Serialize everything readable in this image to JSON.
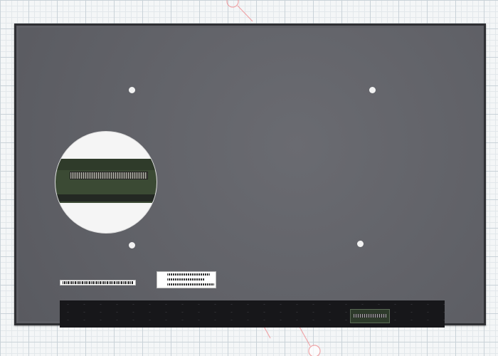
{
  "product": {
    "top_marking": "",
    "colors": {
      "panel": "#5f6066",
      "bezel": "#2e2f33",
      "backdrop_grid": "#c9d2d8",
      "watermark": "#e8424a"
    }
  },
  "zoom_inset": {
    "subject": "edp-connector"
  },
  "labels": {
    "left_barcode": "",
    "right_label_codes": [
      "",
      "",
      ""
    ]
  }
}
